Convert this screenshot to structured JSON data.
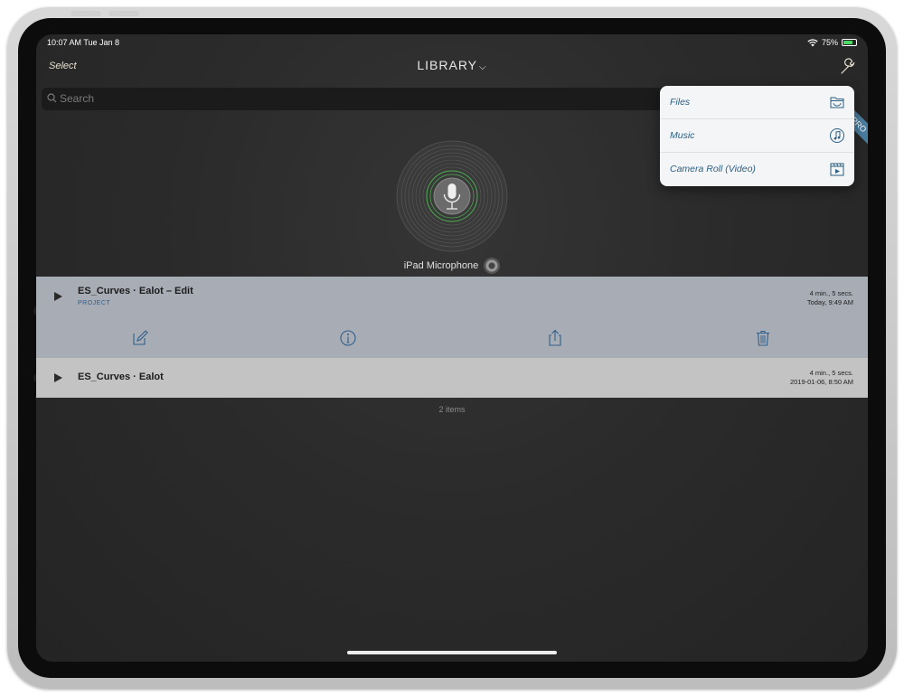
{
  "status_bar": {
    "time_date": "10:07 AM   Tue Jan 8",
    "battery": "75%",
    "battery_level": 0.75
  },
  "nav": {
    "select_label": "Select",
    "title": "LIBRARY",
    "title_chevron": "⌵"
  },
  "search": {
    "placeholder": "Search"
  },
  "input_source": {
    "label": "iPad Microphone"
  },
  "pro_ribbon": "PRO",
  "recordings": [
    {
      "title": "ES_Curves · Ealot – Edit",
      "subtitle": "PROJECT",
      "duration": "4 min., 5 secs.",
      "date": "Today, 9:49 AM",
      "expanded": true
    },
    {
      "title": "ES_Curves · Ealot",
      "subtitle": "",
      "duration": "4 min., 5 secs.",
      "date": "2019-01-06, 8:50 AM",
      "expanded": false
    }
  ],
  "row_actions": [
    "edit-icon",
    "info-icon",
    "share-icon",
    "trash-icon"
  ],
  "footer": {
    "count": "2 items"
  },
  "import_menu": {
    "items": [
      {
        "label": "Files",
        "icon": "folder-icon"
      },
      {
        "label": "Music",
        "icon": "music-note-icon"
      },
      {
        "label": "Camera Roll (Video)",
        "icon": "clapperboard-icon"
      }
    ]
  },
  "colors": {
    "accent": "#2b5f82",
    "row_selected": "#a8acb5",
    "row_normal": "#c3c3c3",
    "screen_bg": "#2b2b2b"
  }
}
